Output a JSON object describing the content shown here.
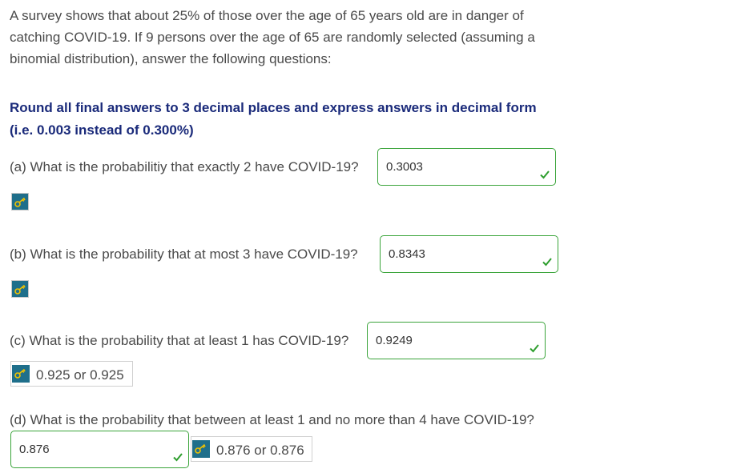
{
  "intro": {
    "line1": "A survey shows that about 25% of those over the age of 65 years old are in danger of",
    "line2": "catching COVID-19. If 9 persons over the age of 65 are randomly selected (assuming a",
    "line3": "binomial distribution), answer the following questions:"
  },
  "instruction": {
    "line1": "Round all final answers to 3 decimal places and express answers in decimal form",
    "line2": "(i.e. 0.003 instead of 0.300%)"
  },
  "questions": [
    {
      "text": "(a) What is the probabilitiy that exactly 2 have COVID-19?",
      "answer": "0.3003",
      "status": "correct"
    },
    {
      "text": "(b) What is the probability that at most 3 have COVID-19?",
      "answer": "0.8343",
      "status": "correct"
    },
    {
      "text": "(c) What is the probability that at least 1 has COVID-19?",
      "answer": "0.9249",
      "status": "correct",
      "revealed": "0.925 or 0.925"
    },
    {
      "text": "(d) What is the probability that between at least 1 and no more than 4 have COVID-19?",
      "answer": "0.876",
      "status": "correct",
      "revealed": "0.876 or 0.876"
    }
  ],
  "icons": {
    "key": "key-icon",
    "check": "check-icon"
  },
  "colors": {
    "correct_border": "#3aa43a",
    "check": "#2e9e2e",
    "instruction_text": "#1a2a7a",
    "key_button": "#1f6f8b"
  }
}
